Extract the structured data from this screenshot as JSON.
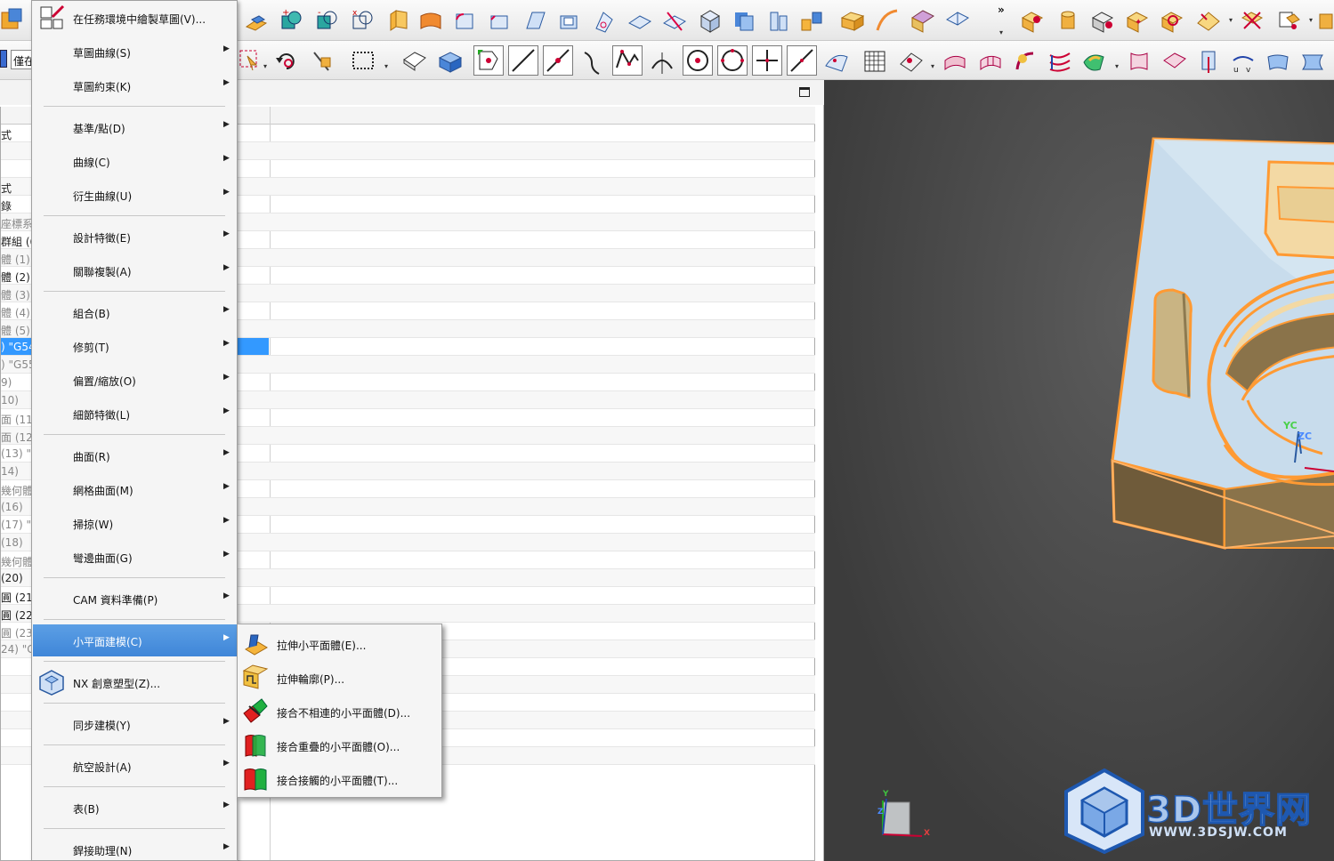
{
  "toolbar": {
    "filter_text": "僅在",
    "overflow_symbol": "»"
  },
  "nav_rows": [
    {
      "text": "式",
      "dim": false
    },
    {
      "text": "",
      "dim": false
    },
    {
      "text": "",
      "dim": false
    },
    {
      "text": "式",
      "dim": false
    },
    {
      "text": "錄",
      "dim": false
    },
    {
      "text": "座標系",
      "dim": true
    },
    {
      "text": "群組 (6",
      "dim": false
    },
    {
      "text": "體 (1) \"",
      "dim": true
    },
    {
      "text": "體 (2) \"",
      "dim": false
    },
    {
      "text": "體 (3) \"",
      "dim": true
    },
    {
      "text": "體 (4) \"",
      "dim": true
    },
    {
      "text": "體 (5) \"",
      "dim": true
    },
    {
      "text": ") \"G54",
      "dim": false,
      "selected": true
    },
    {
      "text": ") \"G55",
      "dim": true
    },
    {
      "text": "9)",
      "dim": true
    },
    {
      "text": "10)",
      "dim": true
    },
    {
      "text": "面 (11)",
      "dim": true
    },
    {
      "text": "面 (12)",
      "dim": true
    },
    {
      "text": "(13) \"",
      "dim": true
    },
    {
      "text": "14)",
      "dim": true
    },
    {
      "text": "幾何體",
      "dim": true
    },
    {
      "text": "(16)",
      "dim": true
    },
    {
      "text": "(17) \"",
      "dim": true
    },
    {
      "text": "(18)",
      "dim": true
    },
    {
      "text": "幾何體",
      "dim": true
    },
    {
      "text": "(20)",
      "dim": false
    },
    {
      "text": "圓 (21)",
      "dim": false
    },
    {
      "text": "圓 (22)",
      "dim": false
    },
    {
      "text": "圓 (23)",
      "dim": true
    },
    {
      "text": "24) \"G5",
      "dim": true
    }
  ],
  "menu": {
    "items": [
      {
        "label": "在任務環境中繪製草圖(V)...",
        "submenu": false,
        "icon": "sketch-task-icon"
      },
      {
        "label": "草圖曲線(S)",
        "submenu": true
      },
      {
        "label": "草圖約束(K)",
        "submenu": true
      },
      {
        "label": "基準/點(D)",
        "submenu": true
      },
      {
        "label": "曲線(C)",
        "submenu": true
      },
      {
        "label": "衍生曲線(U)",
        "submenu": true
      },
      {
        "label": "設計特徵(E)",
        "submenu": true
      },
      {
        "label": "關聯複製(A)",
        "submenu": true
      },
      {
        "label": "組合(B)",
        "submenu": true
      },
      {
        "label": "修剪(T)",
        "submenu": true
      },
      {
        "label": "偏置/縮放(O)",
        "submenu": true
      },
      {
        "label": "細節特徵(L)",
        "submenu": true
      },
      {
        "label": "曲面(R)",
        "submenu": true
      },
      {
        "label": "網格曲面(M)",
        "submenu": true
      },
      {
        "label": "掃掠(W)",
        "submenu": true
      },
      {
        "label": "彎邊曲面(G)",
        "submenu": true
      },
      {
        "label": "CAM 資料準備(P)",
        "submenu": true
      },
      {
        "label": "小平面建模(C)",
        "submenu": true,
        "active": true
      },
      {
        "label": "NX 創意塑型(Z)...",
        "submenu": false,
        "icon": "nx-realize-shape-icon"
      },
      {
        "label": "同步建模(Y)",
        "submenu": true
      },
      {
        "label": "航空設計(A)",
        "submenu": true
      },
      {
        "label": "表(B)",
        "submenu": true
      },
      {
        "label": "銲接助理(N)",
        "submenu": true
      }
    ]
  },
  "submenu": {
    "items": [
      {
        "label": "拉伸小平面體(E)...",
        "icon": "extrude-facet-body-icon"
      },
      {
        "label": "拉伸輪廓(P)...",
        "icon": "extrude-outline-icon"
      },
      {
        "label": "接合不相連的小平面體(D)...",
        "icon": "join-disjoint-facets-icon"
      },
      {
        "label": "接合重疊的小平面體(O)...",
        "icon": "join-overlapping-facets-icon"
      },
      {
        "label": "接合接觸的小平面體(T)...",
        "icon": "join-touching-facets-icon"
      }
    ]
  },
  "viewport": {
    "axis_yc": "YC",
    "axis_zc": "ZC",
    "triad_x": "X",
    "triad_y": "Y",
    "triad_z": "Z"
  },
  "watermark": {
    "brand": "3D世界网",
    "url": "WWW.3DSJW.COM"
  },
  "colors": {
    "model_fill": "#f3d9a4",
    "model_edge": "#ff9a33",
    "menu_highlight": "#4a8edc",
    "selection": "#3399ff",
    "watermark_blue": "#1e58b0"
  }
}
